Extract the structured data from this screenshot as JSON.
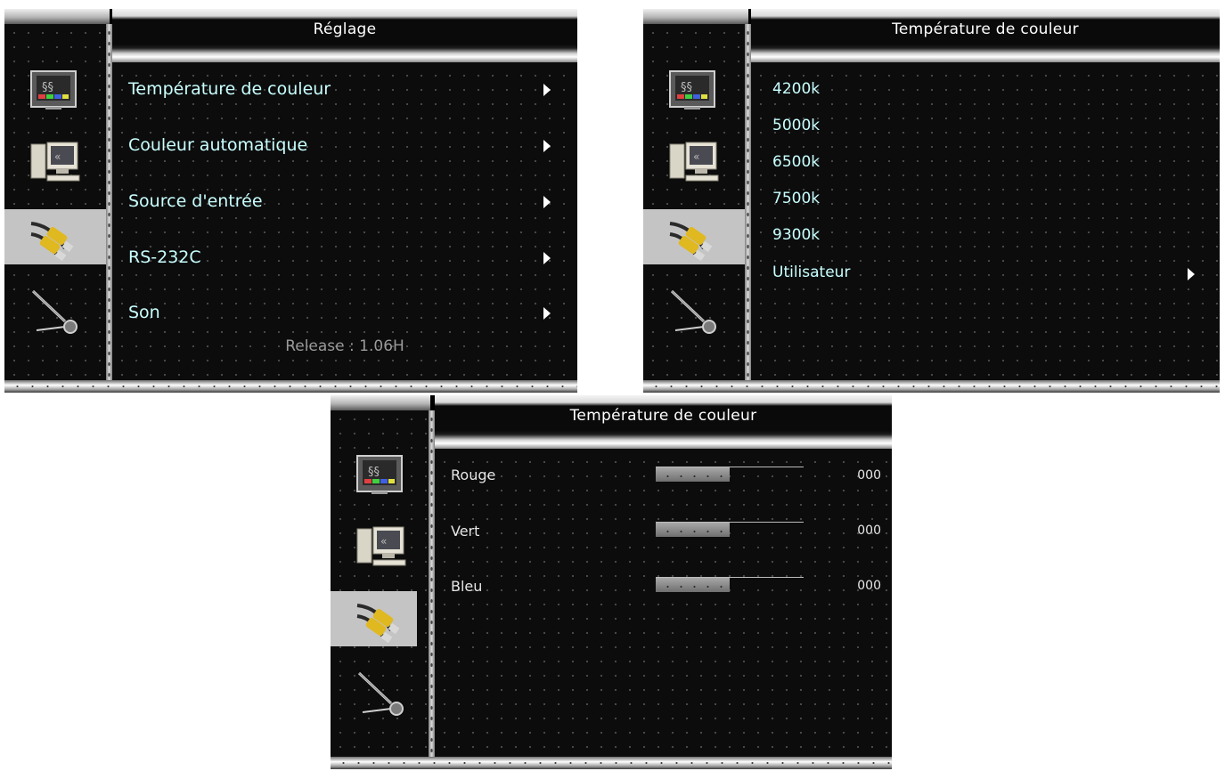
{
  "panels": {
    "reglage": {
      "title": "Réglage",
      "items": [
        {
          "label": "Température de couleur"
        },
        {
          "label": "Couleur automatique"
        },
        {
          "label": "Source d'entrée"
        },
        {
          "label": "RS-232C"
        },
        {
          "label": "Son"
        }
      ],
      "release": "Release : 1.06H"
    },
    "temperature": {
      "title": "Température de couleur",
      "items": [
        "4200k",
        "5000k",
        "6500k",
        "7500k",
        "9300k"
      ],
      "user_item": "Utilisateur"
    },
    "user": {
      "title": "Température de couleur",
      "channels": [
        {
          "label": "Rouge",
          "value": "000",
          "level": 0.5
        },
        {
          "label": "Vert",
          "value": "000",
          "level": 0.5
        },
        {
          "label": "Bleu",
          "value": "000",
          "level": 0.5
        }
      ]
    }
  },
  "sidebar_icons": [
    "picture-icon",
    "pc-icon",
    "av-cables-icon",
    "tool-icon"
  ],
  "selected_icon": "av-cables-icon",
  "colors": {
    "menu_text": "#c9ffff",
    "background": "#0c0c0c",
    "selected_icon_bg": "#c4c4c4"
  }
}
